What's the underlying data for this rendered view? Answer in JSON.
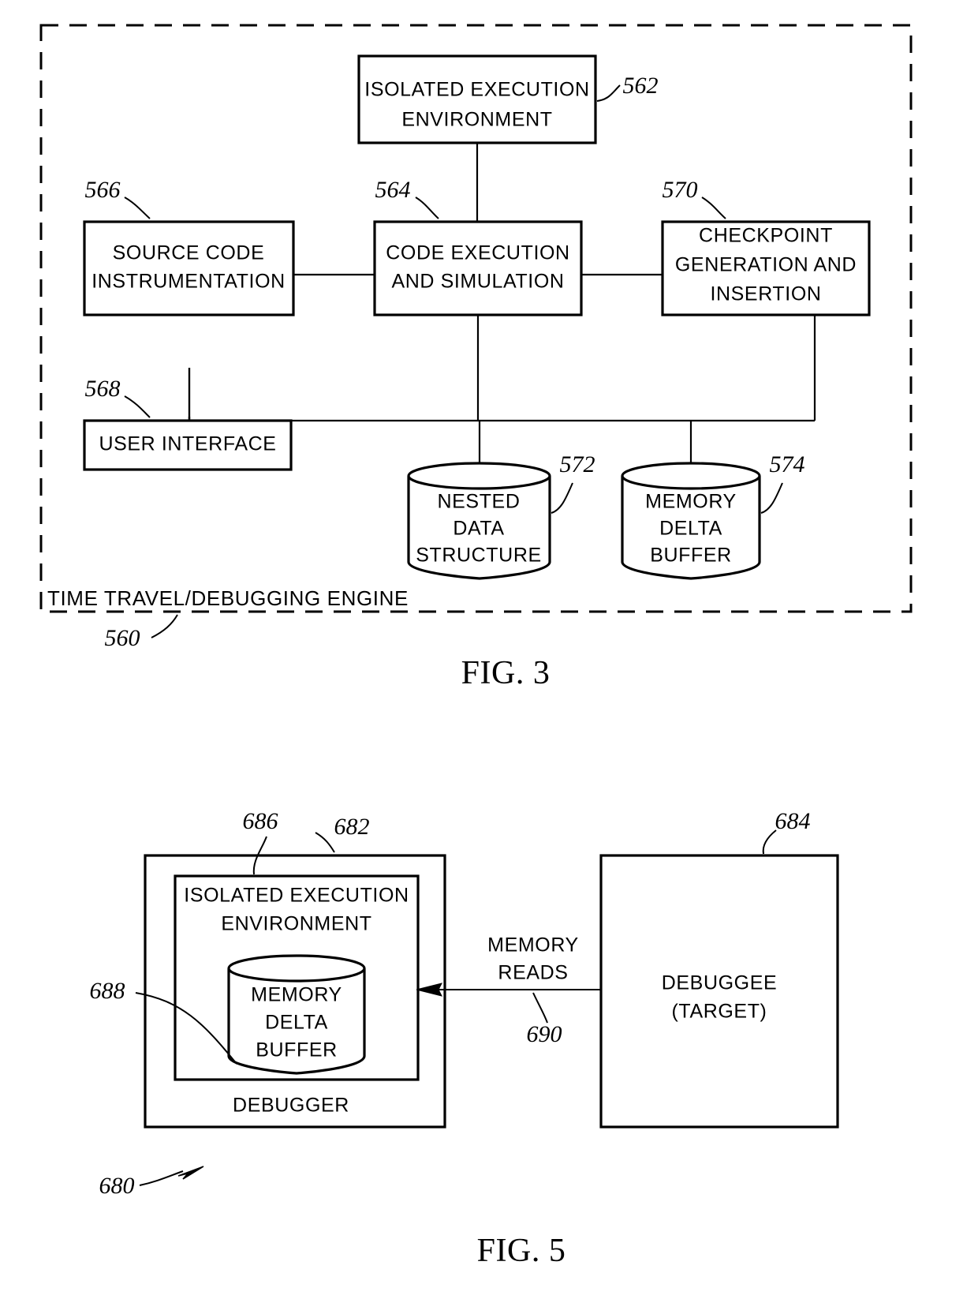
{
  "document": {
    "type": "patent-drawing-sheet",
    "figures": [
      "FIG. 3",
      "FIG. 5"
    ]
  },
  "fig3": {
    "caption": "FIG. 3",
    "container_label": "TIME  TRAVEL/DEBUGGING  ENGINE",
    "container_ref": "560",
    "nodes": [
      {
        "id": "isolated_execution_environment",
        "ref": "562",
        "shape": "rect",
        "lines": [
          "ISOLATED  EXECUTION",
          "ENVIRONMENT"
        ]
      },
      {
        "id": "source_code_instrumentation",
        "ref": "566",
        "shape": "rect",
        "lines": [
          "SOURCE  CODE",
          "INSTRUMENTATION"
        ]
      },
      {
        "id": "code_execution_and_simulation",
        "ref": "564",
        "shape": "rect",
        "lines": [
          "CODE  EXECUTION",
          "AND  SIMULATION"
        ]
      },
      {
        "id": "checkpoint_generation_and_insertion",
        "ref": "570",
        "shape": "rect",
        "lines": [
          "CHECKPOINT",
          "GENERATION  AND",
          "INSERTION"
        ]
      },
      {
        "id": "user_interface",
        "ref": "568",
        "shape": "rect",
        "lines": [
          "USER  INTERFACE"
        ]
      },
      {
        "id": "nested_data_structure",
        "ref": "572",
        "shape": "cylinder",
        "lines": [
          "NESTED",
          "DATA",
          "STRUCTURE"
        ]
      },
      {
        "id": "memory_delta_buffer",
        "ref": "574",
        "shape": "cylinder",
        "lines": [
          "MEMORY",
          "DELTA",
          "BUFFER"
        ]
      }
    ]
  },
  "fig5": {
    "caption": "FIG. 5",
    "system_ref": "680",
    "nodes": [
      {
        "id": "debugger",
        "ref": "682",
        "shape": "rect",
        "lines": [
          "DEBUGGER"
        ]
      },
      {
        "id": "isolated_execution_environment",
        "ref": "686",
        "shape": "rect",
        "lines": [
          "ISOLATED  EXECUTION",
          "ENVIRONMENT"
        ]
      },
      {
        "id": "memory_delta_buffer",
        "ref": "688",
        "shape": "cylinder",
        "lines": [
          "MEMORY",
          "DELTA",
          "BUFFER"
        ]
      },
      {
        "id": "debuggee_target",
        "ref": "684",
        "shape": "rect",
        "lines": [
          "DEBUGGEE",
          "(TARGET)"
        ]
      }
    ],
    "connector": {
      "id": "memory_reads",
      "ref": "690",
      "lines": [
        "MEMORY",
        "READS"
      ],
      "direction": "right-to-left"
    }
  }
}
